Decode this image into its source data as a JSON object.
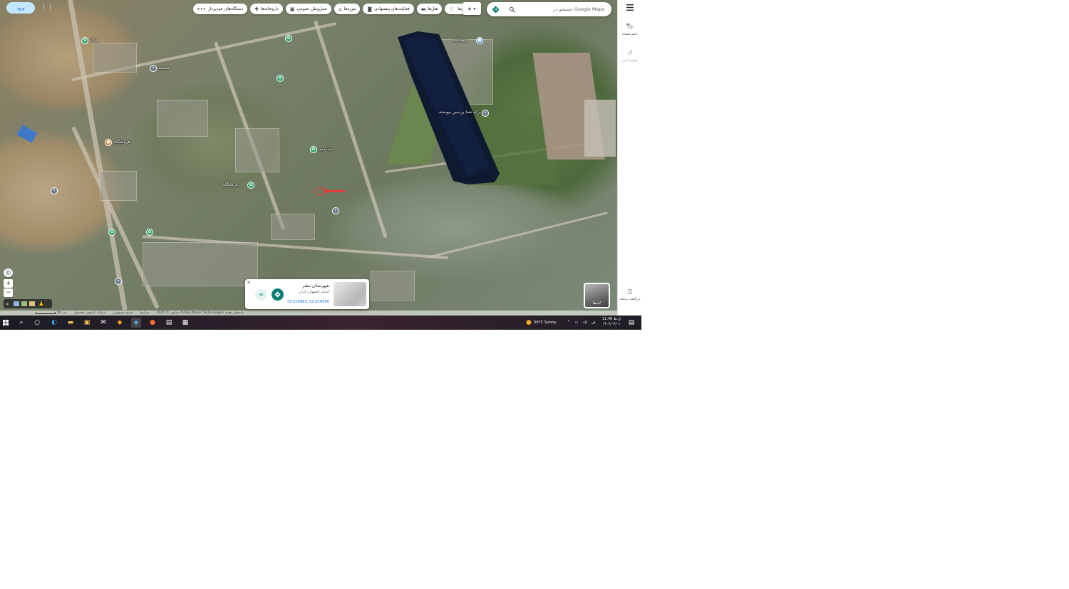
{
  "topbar": {
    "search_placeholder": "جستجو در Google Maps",
    "sign_in": "ورود",
    "chips": [
      {
        "label": "رستوران‌ها",
        "icon": "restaurant-icon"
      },
      {
        "label": "هتل‌ها",
        "icon": "hotel-icon"
      },
      {
        "label": "فعالیت‌های پیشنهادی",
        "icon": "camera-icon"
      },
      {
        "label": "موزه‌ها",
        "icon": "museum-icon"
      },
      {
        "label": "حمل‌ونقل عمومی",
        "icon": "transit-icon"
      },
      {
        "label": "داروخانه‌ها",
        "icon": "pharmacy-icon"
      },
      {
        "label": "دستگاه‌های خودپرداز",
        "icon": "more-icon"
      }
    ]
  },
  "rail": {
    "saved": "ذخیره‌شده",
    "recent": "موارد اخیر",
    "get_app": "دریافت برنامه"
  },
  "map_labels": {
    "lake": "برکه شنا پردیس پیوسته",
    "mosque": "مسجد",
    "park1": "پارک",
    "shop": "فروشگاه",
    "school": "مدرسه",
    "clinic": "درمانگاه",
    "bus": "ایستگاه"
  },
  "map_controls": {
    "layers_label": "لایه‌ها"
  },
  "place_card": {
    "title": "شهرستان نطنز",
    "subtitle": "استان اصفهان، ایران",
    "coords": "33.518983, 51.910590"
  },
  "attribution": {
    "scale": "50 متر",
    "imagery": "تصاویر © 2025 Airbus,Maxar Technologies داده‌های نقشه",
    "terms": "شرایط",
    "privacy": "حریم خصوصی",
    "feedback": "ارسال بازخورد محصول"
  },
  "taskbar": {
    "weather": "39°C  Sunny",
    "time": "11:46 ق.ظ",
    "date": "۱۴۰۴/۰۴/۰۱"
  },
  "colors": {
    "accent": "#0b7d73",
    "marker": "#e53935",
    "signin_bg": "#c2e7ff"
  }
}
